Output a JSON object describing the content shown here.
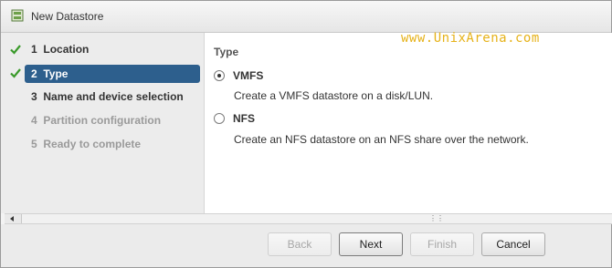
{
  "window": {
    "title": "New Datastore"
  },
  "steps": [
    {
      "number": "1",
      "label": "Location",
      "state": "completed"
    },
    {
      "number": "2",
      "label": "Type",
      "state": "active"
    },
    {
      "number": "3",
      "label": "Name and device selection",
      "state": "enabled"
    },
    {
      "number": "4",
      "label": "Partition configuration",
      "state": "disabled"
    },
    {
      "number": "5",
      "label": "Ready to complete",
      "state": "disabled"
    }
  ],
  "content": {
    "section_label": "Type",
    "watermark": "www.UnixArena.com",
    "options": [
      {
        "label": "VMFS",
        "description": "Create a VMFS datastore on a disk/LUN.",
        "selected": true
      },
      {
        "label": "NFS",
        "description": "Create an NFS datastore on an NFS share over the network.",
        "selected": false
      }
    ]
  },
  "footer": {
    "back_label": "Back",
    "next_label": "Next",
    "finish_label": "Finish",
    "cancel_label": "Cancel"
  },
  "colors": {
    "active_step": "#2d5f8d",
    "check": "#3a9a2a",
    "watermark": "#e6b219"
  },
  "icons": {
    "title": "datastore-icon",
    "completed": "checkmark-icon",
    "scroll_left": "arrow-left-icon",
    "grip": "resize-grip-icon"
  }
}
